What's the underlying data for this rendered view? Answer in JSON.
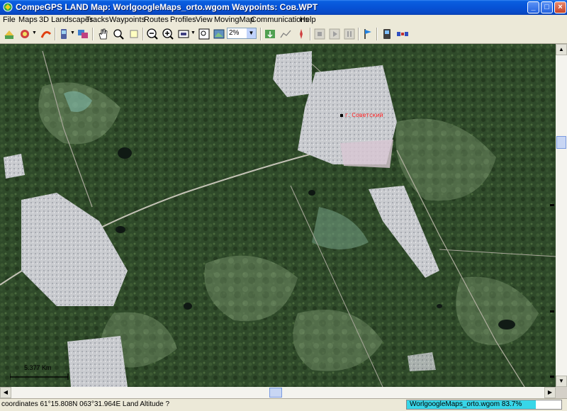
{
  "window": {
    "title": "CompeGPS LAND Map: WorlgoogleMaps_orto.wgom Waypoints:  Сов.WPT",
    "minimize": "_",
    "maximize": "□",
    "close": "×"
  },
  "menu": [
    "File",
    "Maps",
    "3D Landscapes",
    "Tracks",
    "Waypoints",
    "Routes",
    "Profiles",
    "View",
    "MovingMap",
    "Communications",
    "Help"
  ],
  "toolbar": {
    "zoom_value": "2%"
  },
  "map": {
    "waypoint_label": "г. Советский",
    "scale_label": "5.377 Km"
  },
  "status": {
    "coordinates": "coordinates 61°15.808N 063°31.964E Land Altitude ?",
    "map_progress": "WorlgoogleMaps_orto.wgom 83.7%",
    "progress_fraction": 0.837
  },
  "colors": {
    "title_blue": "#0752d6",
    "progress_fill": "#38d6e8",
    "waypoint_red": "#ff2020"
  }
}
